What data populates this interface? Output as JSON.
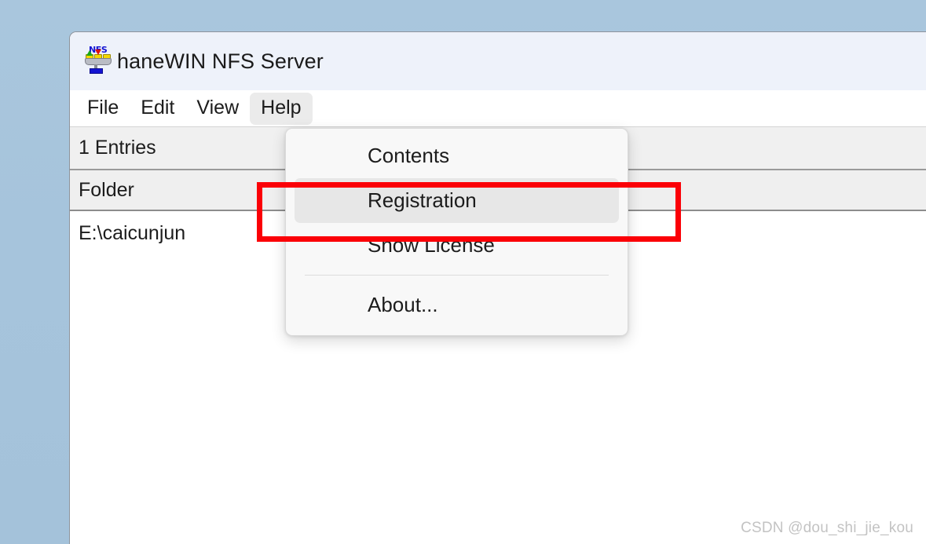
{
  "window": {
    "title": "haneWIN NFS Server",
    "icon": "nfs-server-icon",
    "icon_label": "NFS"
  },
  "menu_bar": {
    "items": [
      {
        "label": "File",
        "open": false
      },
      {
        "label": "Edit",
        "open": false
      },
      {
        "label": "View",
        "open": false
      },
      {
        "label": "Help",
        "open": true
      }
    ]
  },
  "help_menu": {
    "items": [
      {
        "label": "Contents",
        "highlighted": false,
        "separator_after": false
      },
      {
        "label": "Registration",
        "highlighted": true,
        "separator_after": false
      },
      {
        "label": "Show License",
        "highlighted": false,
        "separator_after": true
      },
      {
        "label": "About...",
        "highlighted": false,
        "separator_after": false
      }
    ]
  },
  "status_bar": {
    "entries_text": "1 Entries"
  },
  "list": {
    "columns": [
      "Folder"
    ],
    "rows": [
      {
        "folder": "E:\\caicunjun"
      }
    ]
  },
  "annotation": {
    "type": "highlight-rectangle",
    "color": "#fb0007",
    "targets": "Registration"
  },
  "watermark": {
    "text": "CSDN @dou_shi_jie_kou",
    "color": "#c3c3c3"
  },
  "colors": {
    "desktop_background": "#a6c6de",
    "title_bar": "#eef2fa",
    "menu_bar": "#ffffff",
    "status_bar": "#f0f0f0",
    "column_header": "#efefef",
    "menu_popup": "#f8f8f8",
    "menu_highlight": "#e7e7e7",
    "annotation": "#fb0007"
  }
}
